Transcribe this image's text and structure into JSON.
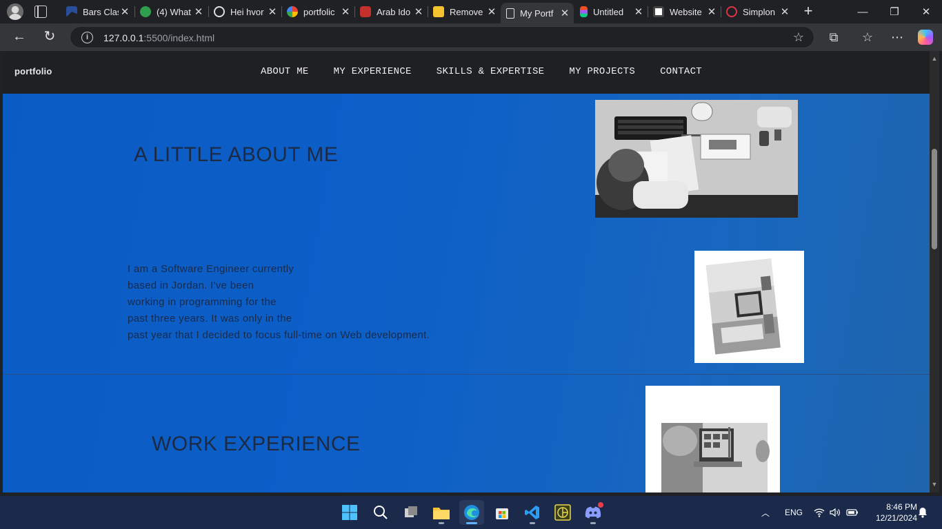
{
  "browser": {
    "tabs": [
      {
        "title": "Bars Clas",
        "active": false
      },
      {
        "title": "(4) What",
        "active": false
      },
      {
        "title": "Hei hvor",
        "active": false
      },
      {
        "title": "portfolic",
        "active": false
      },
      {
        "title": "Arab Ido",
        "active": false
      },
      {
        "title": "Remove",
        "active": false
      },
      {
        "title": "My Portf",
        "active": true
      },
      {
        "title": "Untitled",
        "active": false
      },
      {
        "title": "Website",
        "active": false
      },
      {
        "title": "Simplon",
        "active": false
      }
    ],
    "url_host": "127.0.0.1",
    "url_path": ":5500/index.html"
  },
  "site": {
    "logo": "portfolio",
    "nav": [
      "ABOUT ME",
      "MY EXPERIENCE",
      "SKILLS & EXPERTISE",
      "MY PROJECTS",
      "CONTACT"
    ],
    "about_heading": "A LITTLE ABOUT ME",
    "about_lines": [
      "I am a Software Engineer currently",
      "based in Jordan. I've been",
      "working in programming for the",
      "past three years. It was only in the",
      "past year that I decided to focus full-time on Web development."
    ],
    "work_heading": "WORK EXPERIENCE"
  },
  "taskbar": {
    "language": "ENG",
    "time": "8:46 PM",
    "date": "12/21/2024"
  },
  "colors": {
    "page_blue": "#0b5bc4",
    "site_nav": "#1e2024",
    "heading": "#1d2a44"
  }
}
